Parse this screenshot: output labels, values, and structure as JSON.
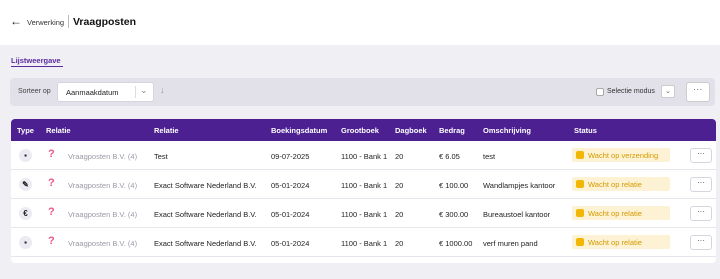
{
  "header": {
    "back_arrow": "←",
    "breadcrumb": "Verwerking",
    "title": "Vraagposten"
  },
  "view": {
    "label": "Lijstweergave"
  },
  "toolbar": {
    "sort_label": "Sorteer op",
    "sort_value": "Aanmaakdatum",
    "sort_direction_icon": "↓",
    "selection_mode_label": "Selectie modus",
    "more_label": "···"
  },
  "table": {
    "columns": [
      "Type",
      "Relatie",
      "Relatie",
      "Boekingsdatum",
      "Grootboek",
      "Dagboek",
      "Bedrag",
      "Omschrijving",
      "Status"
    ],
    "rows": [
      {
        "type_icon": "invoice-icon",
        "type_glyph": "▪",
        "relatie_1": "Vraagposten B.V. (4)",
        "relatie_2": "Test",
        "boekingsdatum": "09-07-2025",
        "grootboek": "1100 - Bank 1",
        "dagboek": "20",
        "bedrag": "€ 6.05",
        "omschrijving": "test",
        "status": "Wacht op verzending"
      },
      {
        "type_icon": "pen-icon",
        "type_glyph": "✎",
        "relatie_1": "Vraagposten B.V. (4)",
        "relatie_2": "Exact Software Nederland B.V.",
        "boekingsdatum": "05-01-2024",
        "grootboek": "1100 - Bank 1",
        "dagboek": "20",
        "bedrag": "€ 100.00",
        "omschrijving": "Wandlampjes kantoor",
        "status": "Wacht op relatie"
      },
      {
        "type_icon": "euro-icon",
        "type_glyph": "€",
        "relatie_1": "Vraagposten B.V. (4)",
        "relatie_2": "Exact Software Nederland B.V.",
        "boekingsdatum": "05-01-2024",
        "grootboek": "1100 - Bank 1",
        "dagboek": "20",
        "bedrag": "€ 300.00",
        "omschrijving": "Bureaustoel kantoor",
        "status": "Wacht op relatie"
      },
      {
        "type_icon": "invoice-icon",
        "type_glyph": "▪",
        "relatie_1": "Vraagposten B.V. (4)",
        "relatie_2": "Exact Software Nederland B.V.",
        "boekingsdatum": "05-01-2024",
        "grootboek": "1100 - Bank 1",
        "dagboek": "20",
        "bedrag": "€ 1000.00",
        "omschrijving": "verf muren pand",
        "status": "Wacht op relatie"
      }
    ]
  },
  "colors": {
    "header_purple": "#4c2091",
    "accent_purple": "#5a2b9e",
    "status_yellow": "#f2b705",
    "question_pink": "#e9578c"
  }
}
